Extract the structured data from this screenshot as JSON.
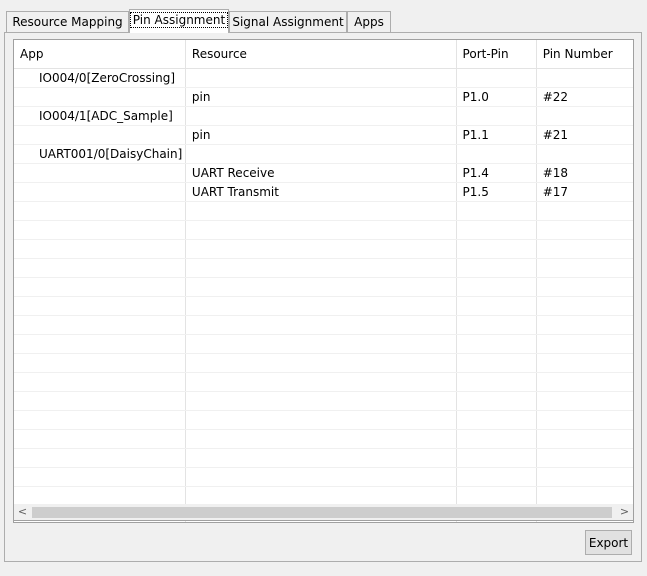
{
  "tabs": [
    {
      "label": "Resource Mapping"
    },
    {
      "label": "Pin Assignment"
    },
    {
      "label": "Signal Assignment"
    },
    {
      "label": "Apps"
    }
  ],
  "table": {
    "headers": [
      "App",
      "Resource",
      "Port-Pin",
      "Pin Number"
    ],
    "rows": [
      {
        "app": "IO004/0[ZeroCrossing]",
        "resource": "",
        "port_pin": "",
        "pin_number": ""
      },
      {
        "app": "",
        "resource": "pin",
        "port_pin": "P1.0",
        "pin_number": "#22"
      },
      {
        "app": "IO004/1[ADC_Sample]",
        "resource": "",
        "port_pin": "",
        "pin_number": ""
      },
      {
        "app": "",
        "resource": "pin",
        "port_pin": "P1.1",
        "pin_number": "#21"
      },
      {
        "app": "UART001/0[DaisyChain]",
        "resource": "",
        "port_pin": "",
        "pin_number": ""
      },
      {
        "app": "",
        "resource": "UART Receive",
        "port_pin": "P1.4",
        "pin_number": "#18"
      },
      {
        "app": "",
        "resource": "UART Transmit",
        "port_pin": "P1.5",
        "pin_number": "#17"
      }
    ]
  },
  "scrollbar": {
    "left_arrow": "<",
    "right_arrow": ">"
  },
  "export_button": {
    "label": "Export"
  }
}
